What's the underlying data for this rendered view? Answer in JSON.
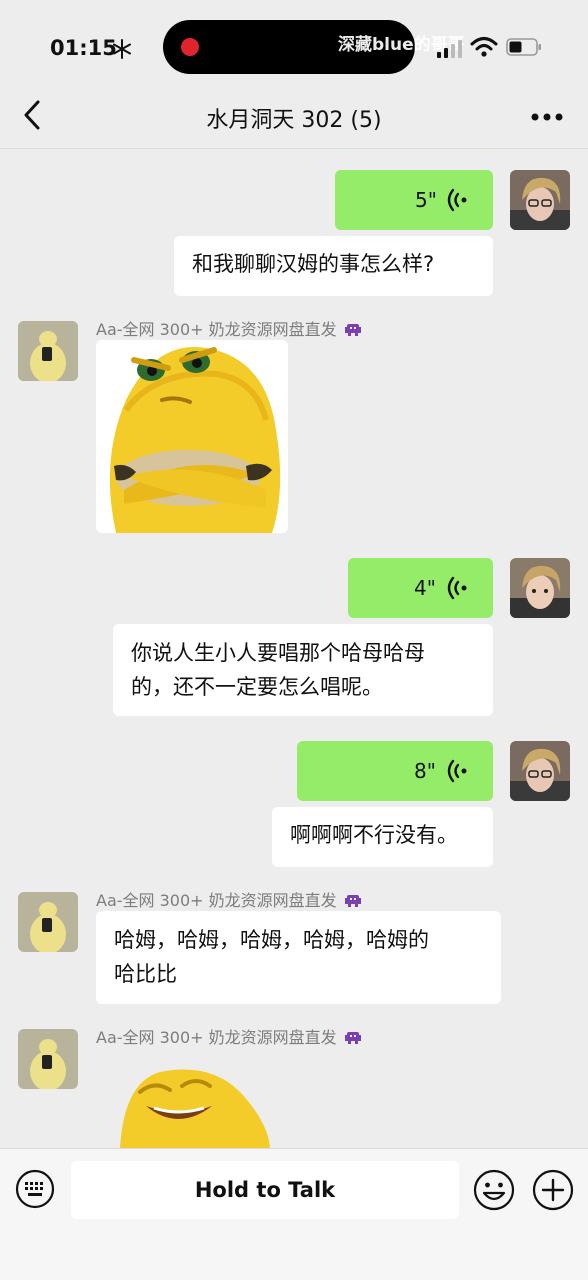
{
  "status_bar": {
    "time": "01:15",
    "watermark": "深藏blue的哥哥"
  },
  "header": {
    "title": "水月洞天 302 (5)"
  },
  "messages": [
    {
      "side": "right",
      "type": "voice",
      "duration": "5\""
    },
    {
      "side": "right",
      "type": "transcript",
      "text": "和我聊聊汉姆的事怎么样?"
    },
    {
      "side": "left",
      "sender": "Aa-全网 300+ 奶龙资源网盘直发",
      "type": "sticker",
      "sticker": "yellow-monster-arms-crossed"
    },
    {
      "side": "right",
      "type": "voice",
      "duration": "4\""
    },
    {
      "side": "right",
      "type": "transcript",
      "text_line1": "你说人生小人要唱那个哈母哈母",
      "text_line2": "的，还不一定要怎么唱呢。"
    },
    {
      "side": "right",
      "type": "voice",
      "duration": "8\""
    },
    {
      "side": "right",
      "type": "transcript",
      "text": "啊啊啊不行没有。"
    },
    {
      "side": "left",
      "sender": "Aa-全网 300+ 奶龙资源网盘直发",
      "type": "text",
      "text_line1": "哈姆，哈姆，哈姆，哈姆，哈姆的",
      "text_line2": "哈比比"
    },
    {
      "side": "left",
      "sender": "Aa-全网 300+ 奶龙资源网盘直发",
      "type": "sticker",
      "sticker": "yellow-monster-laughing"
    }
  ],
  "input_bar": {
    "talk_label": "Hold to Talk"
  },
  "colors": {
    "background": "#ededed",
    "self_bubble": "#95ec69",
    "other_bubble": "#ffffff",
    "record_dot": "#e0242e"
  }
}
